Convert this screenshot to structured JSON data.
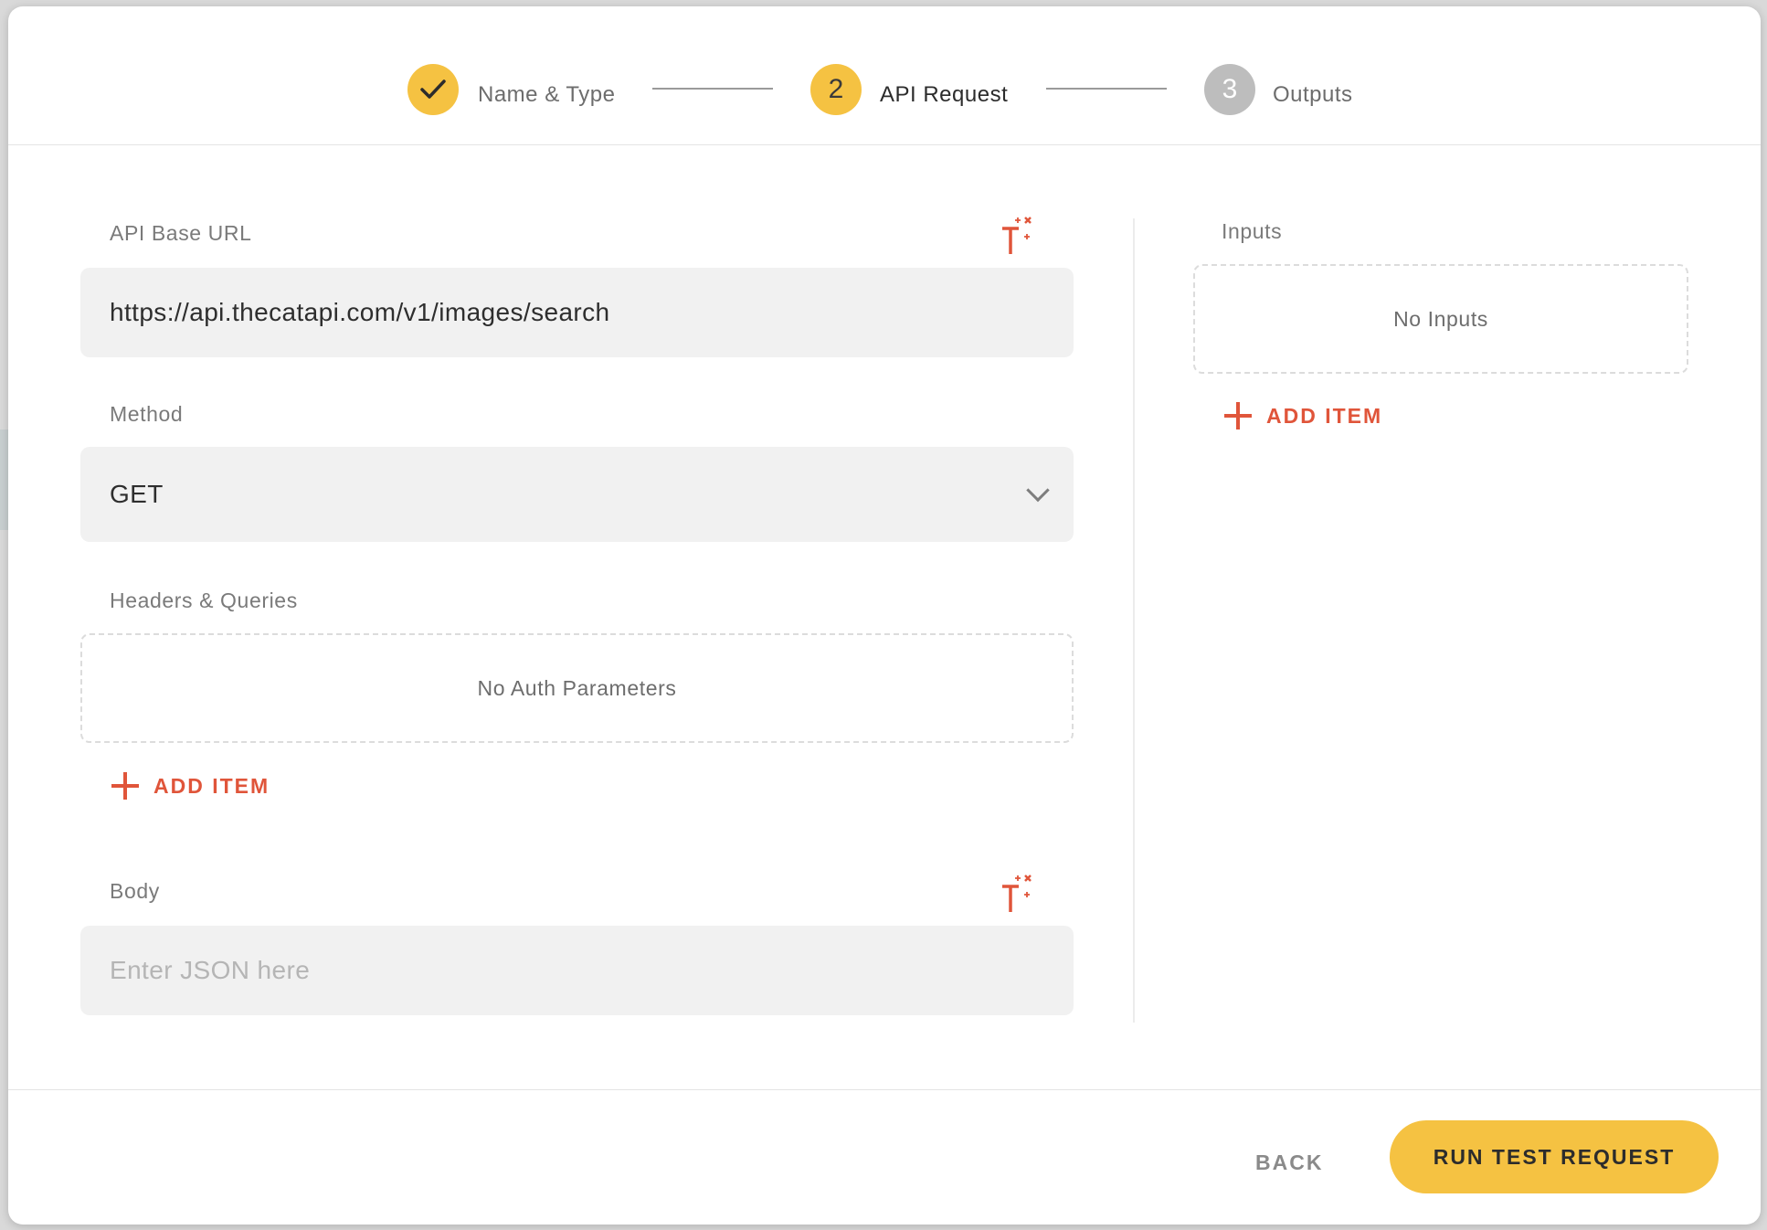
{
  "stepper": {
    "steps": [
      {
        "number": "",
        "label": "Name & Type",
        "state": "done"
      },
      {
        "number": "2",
        "label": "API Request",
        "state": "active"
      },
      {
        "number": "3",
        "label": "Outputs",
        "state": "pending"
      }
    ]
  },
  "form": {
    "base_url": {
      "label": "API Base URL",
      "value": "https://api.thecatapi.com/v1/images/search"
    },
    "method": {
      "label": "Method",
      "selected": "GET"
    },
    "headers": {
      "label": "Headers & Queries",
      "empty_text": "No Auth Parameters",
      "add_label": "ADD ITEM"
    },
    "body": {
      "label": "Body",
      "placeholder": "Enter JSON here"
    }
  },
  "inputs_panel": {
    "label": "Inputs",
    "empty_text": "No Inputs",
    "add_label": "ADD ITEM"
  },
  "footer": {
    "back_label": "BACK",
    "run_label": "RUN TEST REQUEST"
  },
  "colors": {
    "accent": "#f5c242",
    "action": "#e0553a",
    "pending": "#bdbdbd"
  }
}
